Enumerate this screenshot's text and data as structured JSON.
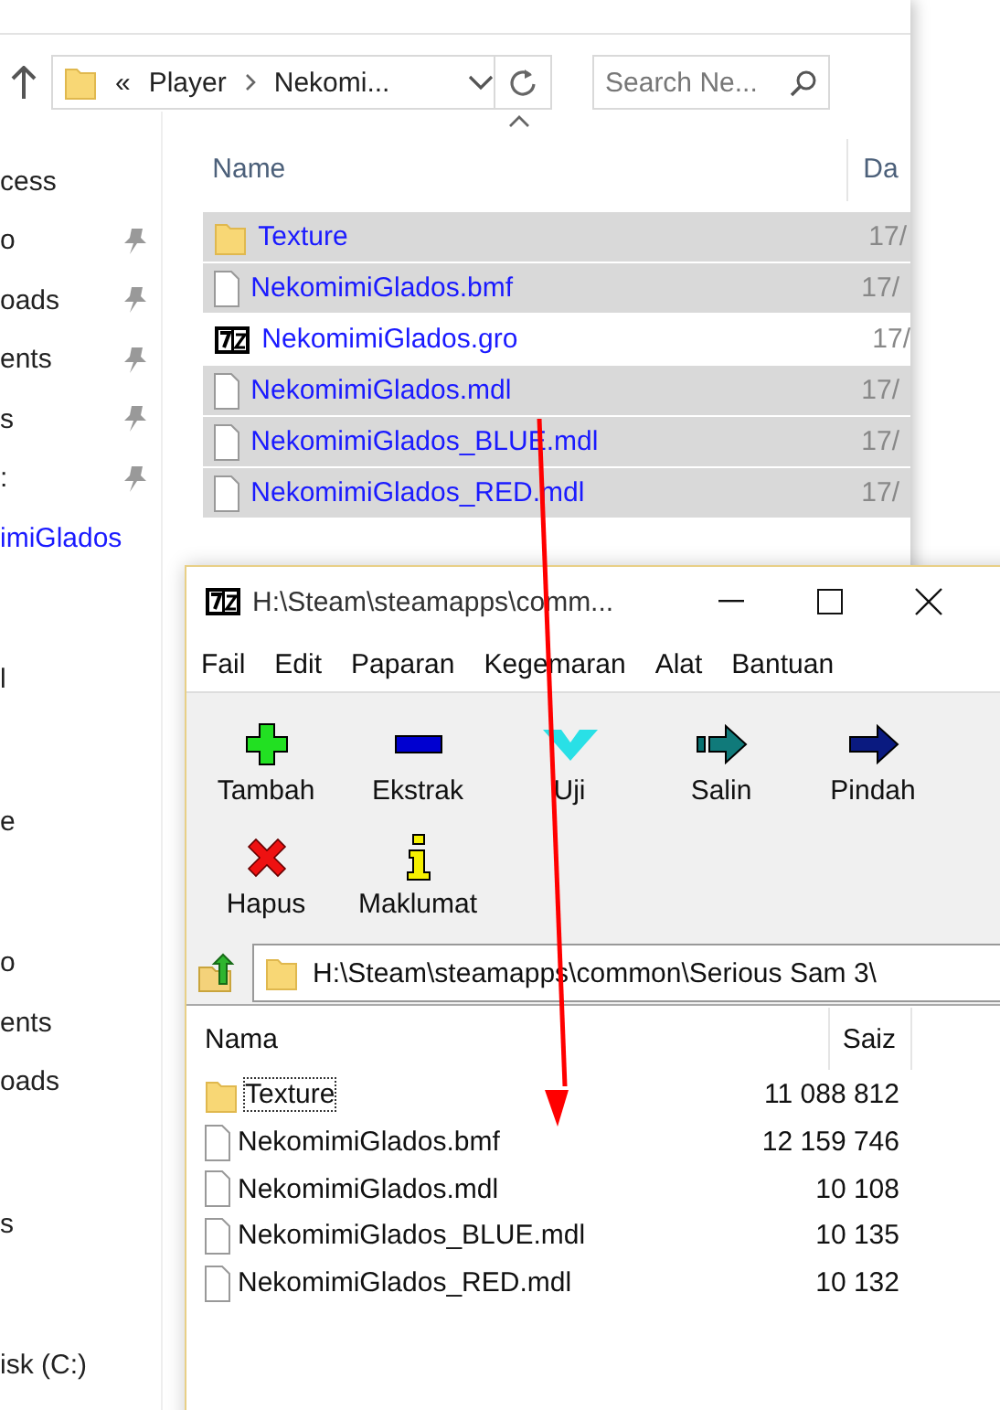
{
  "explorer": {
    "address": {
      "crumbs": [
        "«",
        "Player",
        "Nekomi..."
      ]
    },
    "search": {
      "placeholder": "Search Ne..."
    },
    "sidebar": {
      "groups": [
        {
          "items": [
            {
              "label": "cess",
              "pinned": false,
              "selected": false
            },
            {
              "label": "o",
              "pinned": true,
              "selected": false
            },
            {
              "label": "oads",
              "pinned": true,
              "selected": false
            },
            {
              "label": "ents",
              "pinned": true,
              "selected": false
            },
            {
              "label": "s",
              "pinned": true,
              "selected": false
            },
            {
              "label": ":",
              "pinned": true,
              "selected": false
            },
            {
              "label": "imiGlados",
              "pinned": false,
              "selected": true
            }
          ]
        },
        {
          "items": [
            {
              "label": "l",
              "pinned": false,
              "selected": false
            }
          ]
        },
        {
          "items": [
            {
              "label": "e",
              "pinned": false,
              "selected": false
            }
          ]
        },
        {
          "items": [
            {
              "label": "o",
              "pinned": false,
              "selected": false
            },
            {
              "label": "ents",
              "pinned": false,
              "selected": false
            },
            {
              "label": "oads",
              "pinned": false,
              "selected": false
            }
          ]
        },
        {
          "items": [
            {
              "label": "s",
              "pinned": false,
              "selected": false
            }
          ]
        },
        {
          "items": [
            {
              "label": "isk (C:)",
              "pinned": false,
              "selected": false
            }
          ]
        }
      ]
    },
    "columns": [
      "Name",
      "Da"
    ],
    "files": [
      {
        "name": "Texture",
        "kind": "folder",
        "date": "17/",
        "selected": true
      },
      {
        "name": "NekomimiGlados.bmf",
        "kind": "file",
        "date": "17/",
        "selected": true
      },
      {
        "name": "NekomimiGlados.gro",
        "kind": "archive",
        "date": "17/",
        "selected": false
      },
      {
        "name": "NekomimiGlados.mdl",
        "kind": "file",
        "date": "17/",
        "selected": true
      },
      {
        "name": "NekomimiGlados_BLUE.mdl",
        "kind": "file",
        "date": "17/",
        "selected": true
      },
      {
        "name": "NekomimiGlados_RED.mdl",
        "kind": "file",
        "date": "17/",
        "selected": true
      }
    ]
  },
  "archive_window": {
    "title": "H:\\Steam\\steamapps\\comm...",
    "menu": [
      "Fail",
      "Edit",
      "Paparan",
      "Kegemaran",
      "Alat",
      "Bantuan"
    ],
    "toolbar": [
      [
        {
          "label": "Tambah",
          "kind": "add"
        },
        {
          "label": "Ekstrak",
          "kind": "extract"
        },
        {
          "label": "Uji",
          "kind": "test"
        },
        {
          "label": "Salin",
          "kind": "copy"
        },
        {
          "label": "Pindah",
          "kind": "move"
        }
      ],
      [
        {
          "label": "Hapus",
          "kind": "delete"
        },
        {
          "label": "Maklumat",
          "kind": "info"
        }
      ]
    ],
    "path": "H:\\Steam\\steamapps\\common\\Serious Sam 3\\",
    "columns": [
      "Nama",
      "Saiz"
    ],
    "files": [
      {
        "name": "Texture",
        "kind": "folder",
        "size": "11 088 812",
        "focused": true
      },
      {
        "name": "NekomimiGlados.bmf",
        "kind": "file",
        "size": "12 159 746",
        "focused": false
      },
      {
        "name": "NekomimiGlados.mdl",
        "kind": "file",
        "size": "10 108",
        "focused": false
      },
      {
        "name": "NekomimiGlados_BLUE.mdl",
        "kind": "file",
        "size": "10 135",
        "focused": false
      },
      {
        "name": "NekomimiGlados_RED.mdl",
        "kind": "file",
        "size": "10 132",
        "focused": false
      }
    ]
  }
}
